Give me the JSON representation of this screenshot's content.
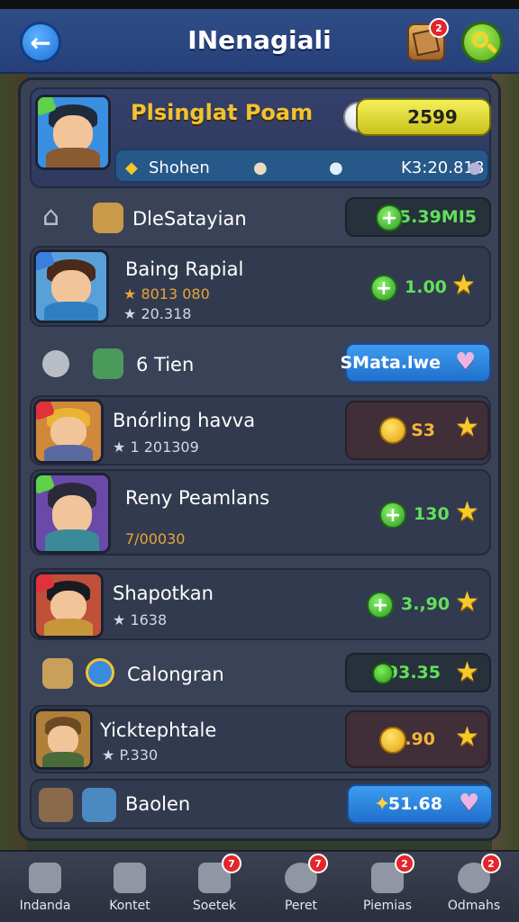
{
  "header": {
    "title": "INenagiali",
    "back_icon": "arrow-left-icon",
    "chest_badge": "2",
    "colors": {
      "header_bg": "#2e4d86",
      "accent_green": "#4aa81c",
      "accent_blue": "#1f6fd6"
    }
  },
  "profile": {
    "name": "Plsinglat Poam",
    "score": "2599",
    "bar": {
      "item1": "Shohen",
      "stat": "K3:20.818"
    }
  },
  "rows": [
    {
      "title": "DleSatayian",
      "value": "5.39MI5"
    },
    {
      "title": "Baing Rapial",
      "sub1": "8013 080",
      "sub2": "20.318",
      "value": "1.00"
    },
    {
      "title": "6 Tien",
      "value": "SMata.lwe"
    },
    {
      "title": "Bnórling havva",
      "sub1": "1 201309",
      "value": "S3"
    },
    {
      "title": "Reny Peamlans",
      "sub1": "7/00030",
      "value": "130"
    },
    {
      "title": "Shapotkan",
      "sub1": "1638",
      "value": "3.,90"
    },
    {
      "title": "Calongran",
      "value": "93.35"
    },
    {
      "title": "Yicktephtale",
      "sub1": "P.330",
      "value": "..90"
    },
    {
      "title": "Baolen",
      "value": "51.68"
    }
  ],
  "nav": [
    {
      "label": "Indanda",
      "icon": "home-icon"
    },
    {
      "label": "Kontet",
      "icon": "butterfly-icon"
    },
    {
      "label": "Soetek",
      "icon": "news-icon",
      "badge": "7"
    },
    {
      "label": "Peret",
      "icon": "settings-icon",
      "badge": "7"
    },
    {
      "label": "Piemias",
      "icon": "puzzle-icon",
      "badge": "2"
    },
    {
      "label": "Odmahs",
      "icon": "profile-icon",
      "badge": "2"
    }
  ]
}
